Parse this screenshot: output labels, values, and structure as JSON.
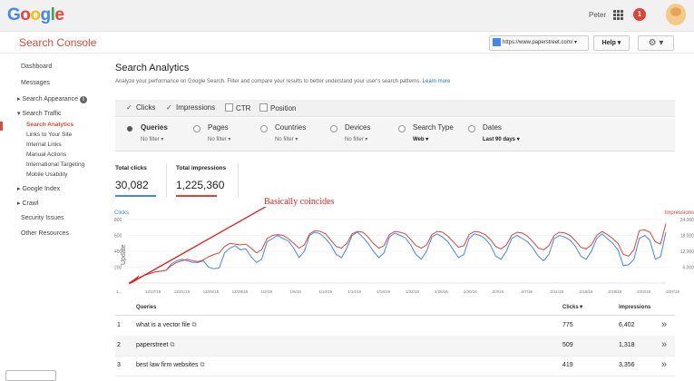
{
  "header": {
    "logo_letters": [
      {
        "ch": "G",
        "color": "#4285f4"
      },
      {
        "ch": "o",
        "color": "#ea4335"
      },
      {
        "ch": "o",
        "color": "#fbbc05"
      },
      {
        "ch": "g",
        "color": "#4285f4"
      },
      {
        "ch": "l",
        "color": "#34a853"
      },
      {
        "ch": "e",
        "color": "#ea4335"
      }
    ],
    "user_name": "Peter",
    "notification_count": "1"
  },
  "console_bar": {
    "title": "Search Console",
    "property": "https://www.paperstreet.com/",
    "help_label": "Help",
    "settings_icon": "gear-icon"
  },
  "sidebar": {
    "items": [
      {
        "label": "Dashboard"
      },
      {
        "label": "Messages"
      },
      {
        "label": "Search Appearance",
        "info": "i"
      },
      {
        "label": "Search Traffic"
      },
      {
        "label": "Search Analytics"
      },
      {
        "label": "Links to Your Site"
      },
      {
        "label": "Internal Links"
      },
      {
        "label": "Manual Actions"
      },
      {
        "label": "International Targeting"
      },
      {
        "label": "Mobile Usability"
      },
      {
        "label": "Google Index"
      },
      {
        "label": "Crawl"
      },
      {
        "label": "Security Issues"
      },
      {
        "label": "Other Resources"
      }
    ]
  },
  "main": {
    "title": "Search Analytics",
    "subtitle": "Analyze your performance on Google Search. Filter and compare your results to better understand your user's search patterns.",
    "learn_more": "Learn more"
  },
  "metrics": [
    {
      "label": "Clicks",
      "checked": true
    },
    {
      "label": "Impressions",
      "checked": true
    },
    {
      "label": "CTR",
      "checked": false
    },
    {
      "label": "Position",
      "checked": false
    }
  ],
  "filters": [
    {
      "label": "Queries",
      "sub": "No filter",
      "selected": true
    },
    {
      "label": "Pages",
      "sub": "No filter",
      "selected": false
    },
    {
      "label": "Countries",
      "sub": "No filter",
      "selected": false
    },
    {
      "label": "Devices",
      "sub": "No filter",
      "selected": false
    },
    {
      "label": "Search Type",
      "sub": "Web",
      "selected": false
    },
    {
      "label": "Dates",
      "sub": "Last 90 days",
      "selected": false
    }
  ],
  "totals": {
    "clicks_label": "Total clicks",
    "clicks_value": "30,082",
    "impressions_label": "Total impressions",
    "impressions_value": "1,225,360"
  },
  "annotation": {
    "text": "Basically coincides",
    "color": "#e02020"
  },
  "chart_data": {
    "type": "line",
    "left_axis_label": "Clicks",
    "right_axis_label": "Impressions",
    "left_ticks": [
      "800",
      "600",
      "400",
      "200"
    ],
    "right_ticks": [
      "24,000",
      "18,000",
      "12,000",
      "6,000"
    ],
    "y_left_range": [
      0,
      800
    ],
    "y_right_range": [
      0,
      24000
    ],
    "vertical_label": "Update",
    "x_tick_labels": [
      "1...",
      "12/17/15",
      "12/21/15",
      "12/25/15",
      "12/29/15",
      "1/2/16",
      "1/6/16",
      "1/10/16",
      "1/14/16",
      "1/18/16",
      "1/22/16",
      "1/26/16",
      "1/30/16",
      "2/3/16",
      "2/7/16",
      "2/11/16",
      "2/15/16",
      "2/19/16",
      "2/23/16",
      "2/27/16"
    ],
    "series": [
      {
        "name": "Clicks",
        "color": "#4285f4",
        "values": [
          0,
          40,
          70,
          100,
          120,
          140,
          150,
          160,
          240,
          280,
          300,
          280,
          260,
          260,
          280,
          200,
          180,
          190,
          380,
          440,
          470,
          420,
          430,
          330,
          260,
          300,
          520,
          560,
          600,
          560,
          530,
          440,
          320,
          400,
          600,
          640,
          620,
          560,
          480,
          360,
          320,
          440,
          600,
          640,
          580,
          500,
          400,
          320,
          380,
          580,
          630,
          600,
          570,
          480,
          360,
          300,
          400,
          580,
          620,
          580,
          520,
          420,
          320,
          360,
          560,
          620,
          600,
          560,
          480,
          340,
          300,
          400,
          560,
          600,
          560,
          520,
          440,
          340,
          280,
          360,
          560,
          600,
          580,
          540,
          460,
          340,
          300,
          400,
          560,
          620,
          560,
          500,
          420,
          220,
          230,
          300,
          560,
          600,
          540,
          300,
          330,
          640
        ]
      },
      {
        "name": "Impressions",
        "color": "#db4437",
        "values": [
          0,
          1200,
          2100,
          3000,
          3600,
          4200,
          4500,
          4800,
          6600,
          7800,
          8400,
          9000,
          8400,
          8100,
          8700,
          9900,
          10800,
          11400,
          13800,
          15000,
          14700,
          14400,
          14700,
          13200,
          11400,
          12600,
          16800,
          18000,
          18300,
          18000,
          16800,
          15000,
          13200,
          14400,
          18600,
          19800,
          19500,
          18600,
          16200,
          13800,
          13200,
          15000,
          18600,
          19500,
          19200,
          17400,
          15000,
          13200,
          14100,
          18300,
          19500,
          19200,
          18600,
          16500,
          14100,
          13200,
          14400,
          18300,
          19500,
          19200,
          17700,
          15600,
          13500,
          14100,
          18300,
          19500,
          19200,
          18300,
          16500,
          13800,
          12900,
          14400,
          18000,
          19200,
          18900,
          17700,
          15600,
          13200,
          12600,
          14100,
          18000,
          19200,
          18900,
          18000,
          15900,
          13500,
          12900,
          14400,
          18000,
          19500,
          18300,
          16800,
          15000,
          10800,
          10200,
          12600,
          19800,
          20100,
          19200,
          15600,
          14700,
          22500
        ]
      }
    ]
  },
  "table": {
    "headers": {
      "query": "Queries",
      "clicks": "Clicks▼",
      "impressions": "Impressions"
    },
    "rows": [
      {
        "rank": "1",
        "query": "what is a vector file",
        "clicks": "775",
        "impressions": "6,402"
      },
      {
        "rank": "2",
        "query": "paperstreet",
        "clicks": "509",
        "impressions": "1,318"
      },
      {
        "rank": "3",
        "query": "best law firm websites",
        "clicks": "419",
        "impressions": "3,356"
      }
    ],
    "row_icon": "external-link-icon",
    "row_action_icon": "double-chevron-right-icon"
  }
}
